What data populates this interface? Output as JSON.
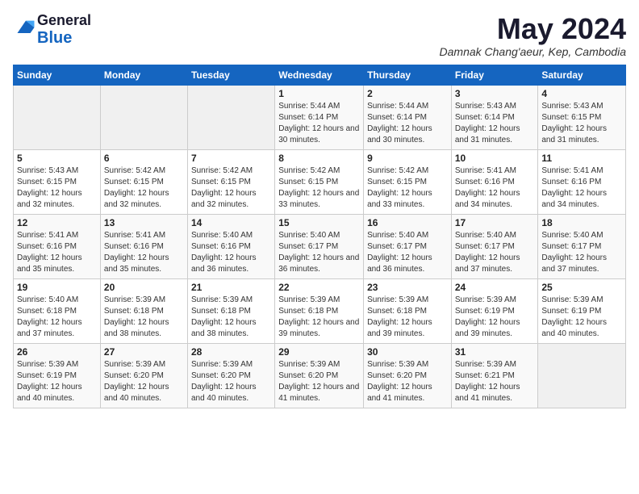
{
  "logo": {
    "general": "General",
    "blue": "Blue"
  },
  "header": {
    "month_year": "May 2024",
    "location": "Damnak Chang'aeur, Kep, Cambodia"
  },
  "weekdays": [
    "Sunday",
    "Monday",
    "Tuesday",
    "Wednesday",
    "Thursday",
    "Friday",
    "Saturday"
  ],
  "weeks": [
    [
      {
        "day": "",
        "sunrise": "",
        "sunset": "",
        "daylight": ""
      },
      {
        "day": "",
        "sunrise": "",
        "sunset": "",
        "daylight": ""
      },
      {
        "day": "",
        "sunrise": "",
        "sunset": "",
        "daylight": ""
      },
      {
        "day": "1",
        "sunrise": "Sunrise: 5:44 AM",
        "sunset": "Sunset: 6:14 PM",
        "daylight": "Daylight: 12 hours and 30 minutes."
      },
      {
        "day": "2",
        "sunrise": "Sunrise: 5:44 AM",
        "sunset": "Sunset: 6:14 PM",
        "daylight": "Daylight: 12 hours and 30 minutes."
      },
      {
        "day": "3",
        "sunrise": "Sunrise: 5:43 AM",
        "sunset": "Sunset: 6:14 PM",
        "daylight": "Daylight: 12 hours and 31 minutes."
      },
      {
        "day": "4",
        "sunrise": "Sunrise: 5:43 AM",
        "sunset": "Sunset: 6:15 PM",
        "daylight": "Daylight: 12 hours and 31 minutes."
      }
    ],
    [
      {
        "day": "5",
        "sunrise": "Sunrise: 5:43 AM",
        "sunset": "Sunset: 6:15 PM",
        "daylight": "Daylight: 12 hours and 32 minutes."
      },
      {
        "day": "6",
        "sunrise": "Sunrise: 5:42 AM",
        "sunset": "Sunset: 6:15 PM",
        "daylight": "Daylight: 12 hours and 32 minutes."
      },
      {
        "day": "7",
        "sunrise": "Sunrise: 5:42 AM",
        "sunset": "Sunset: 6:15 PM",
        "daylight": "Daylight: 12 hours and 32 minutes."
      },
      {
        "day": "8",
        "sunrise": "Sunrise: 5:42 AM",
        "sunset": "Sunset: 6:15 PM",
        "daylight": "Daylight: 12 hours and 33 minutes."
      },
      {
        "day": "9",
        "sunrise": "Sunrise: 5:42 AM",
        "sunset": "Sunset: 6:15 PM",
        "daylight": "Daylight: 12 hours and 33 minutes."
      },
      {
        "day": "10",
        "sunrise": "Sunrise: 5:41 AM",
        "sunset": "Sunset: 6:16 PM",
        "daylight": "Daylight: 12 hours and 34 minutes."
      },
      {
        "day": "11",
        "sunrise": "Sunrise: 5:41 AM",
        "sunset": "Sunset: 6:16 PM",
        "daylight": "Daylight: 12 hours and 34 minutes."
      }
    ],
    [
      {
        "day": "12",
        "sunrise": "Sunrise: 5:41 AM",
        "sunset": "Sunset: 6:16 PM",
        "daylight": "Daylight: 12 hours and 35 minutes."
      },
      {
        "day": "13",
        "sunrise": "Sunrise: 5:41 AM",
        "sunset": "Sunset: 6:16 PM",
        "daylight": "Daylight: 12 hours and 35 minutes."
      },
      {
        "day": "14",
        "sunrise": "Sunrise: 5:40 AM",
        "sunset": "Sunset: 6:16 PM",
        "daylight": "Daylight: 12 hours and 36 minutes."
      },
      {
        "day": "15",
        "sunrise": "Sunrise: 5:40 AM",
        "sunset": "Sunset: 6:17 PM",
        "daylight": "Daylight: 12 hours and 36 minutes."
      },
      {
        "day": "16",
        "sunrise": "Sunrise: 5:40 AM",
        "sunset": "Sunset: 6:17 PM",
        "daylight": "Daylight: 12 hours and 36 minutes."
      },
      {
        "day": "17",
        "sunrise": "Sunrise: 5:40 AM",
        "sunset": "Sunset: 6:17 PM",
        "daylight": "Daylight: 12 hours and 37 minutes."
      },
      {
        "day": "18",
        "sunrise": "Sunrise: 5:40 AM",
        "sunset": "Sunset: 6:17 PM",
        "daylight": "Daylight: 12 hours and 37 minutes."
      }
    ],
    [
      {
        "day": "19",
        "sunrise": "Sunrise: 5:40 AM",
        "sunset": "Sunset: 6:18 PM",
        "daylight": "Daylight: 12 hours and 37 minutes."
      },
      {
        "day": "20",
        "sunrise": "Sunrise: 5:39 AM",
        "sunset": "Sunset: 6:18 PM",
        "daylight": "Daylight: 12 hours and 38 minutes."
      },
      {
        "day": "21",
        "sunrise": "Sunrise: 5:39 AM",
        "sunset": "Sunset: 6:18 PM",
        "daylight": "Daylight: 12 hours and 38 minutes."
      },
      {
        "day": "22",
        "sunrise": "Sunrise: 5:39 AM",
        "sunset": "Sunset: 6:18 PM",
        "daylight": "Daylight: 12 hours and 39 minutes."
      },
      {
        "day": "23",
        "sunrise": "Sunrise: 5:39 AM",
        "sunset": "Sunset: 6:18 PM",
        "daylight": "Daylight: 12 hours and 39 minutes."
      },
      {
        "day": "24",
        "sunrise": "Sunrise: 5:39 AM",
        "sunset": "Sunset: 6:19 PM",
        "daylight": "Daylight: 12 hours and 39 minutes."
      },
      {
        "day": "25",
        "sunrise": "Sunrise: 5:39 AM",
        "sunset": "Sunset: 6:19 PM",
        "daylight": "Daylight: 12 hours and 40 minutes."
      }
    ],
    [
      {
        "day": "26",
        "sunrise": "Sunrise: 5:39 AM",
        "sunset": "Sunset: 6:19 PM",
        "daylight": "Daylight: 12 hours and 40 minutes."
      },
      {
        "day": "27",
        "sunrise": "Sunrise: 5:39 AM",
        "sunset": "Sunset: 6:20 PM",
        "daylight": "Daylight: 12 hours and 40 minutes."
      },
      {
        "day": "28",
        "sunrise": "Sunrise: 5:39 AM",
        "sunset": "Sunset: 6:20 PM",
        "daylight": "Daylight: 12 hours and 40 minutes."
      },
      {
        "day": "29",
        "sunrise": "Sunrise: 5:39 AM",
        "sunset": "Sunset: 6:20 PM",
        "daylight": "Daylight: 12 hours and 41 minutes."
      },
      {
        "day": "30",
        "sunrise": "Sunrise: 5:39 AM",
        "sunset": "Sunset: 6:20 PM",
        "daylight": "Daylight: 12 hours and 41 minutes."
      },
      {
        "day": "31",
        "sunrise": "Sunrise: 5:39 AM",
        "sunset": "Sunset: 6:21 PM",
        "daylight": "Daylight: 12 hours and 41 minutes."
      },
      {
        "day": "",
        "sunrise": "",
        "sunset": "",
        "daylight": ""
      }
    ]
  ]
}
